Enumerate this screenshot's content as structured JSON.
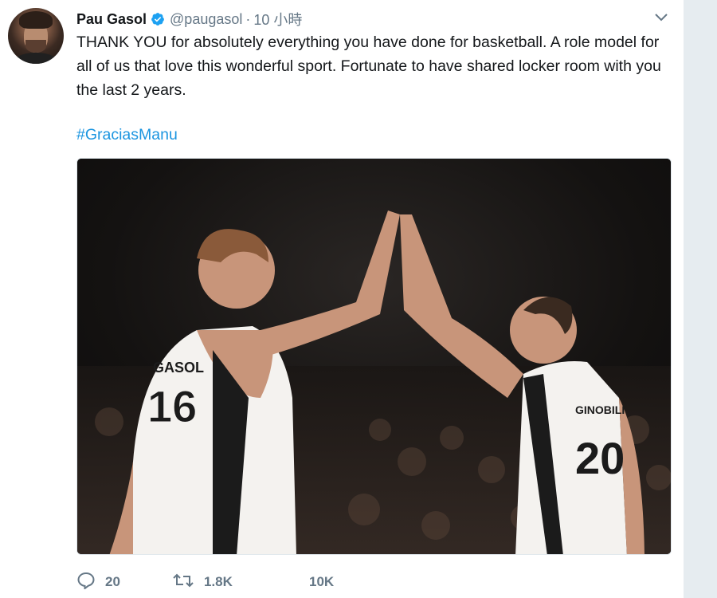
{
  "author": {
    "display_name": "Pau Gasol",
    "handle": "@paugasol",
    "separator": "·",
    "timestamp": "10 小時",
    "verified": true
  },
  "tweet": {
    "text": "THANK YOU for absolutely everything you have done for basketball. A role model for all of us that love this wonderful sport. Fortunate to have shared locker room with you the last 2 years.",
    "hashtag": "#GraciasManu"
  },
  "media": {
    "jersey_left_name": "GASOL",
    "jersey_left_number": "16",
    "jersey_right_name": "GINOBILI",
    "jersey_right_number": "20"
  },
  "actions": {
    "reply_count": "20",
    "retweet_count": "1.8K",
    "like_count": "10K"
  },
  "colors": {
    "link": "#1b95e0",
    "secondary_text": "#657786",
    "verified": "#1da1f2",
    "gutter": "#e6ecf0"
  },
  "icons": {
    "reply": "speech-bubble-icon",
    "retweet": "retweet-arrows-icon",
    "caret": "chevron-down-icon",
    "verified": "verified-badge-icon"
  }
}
